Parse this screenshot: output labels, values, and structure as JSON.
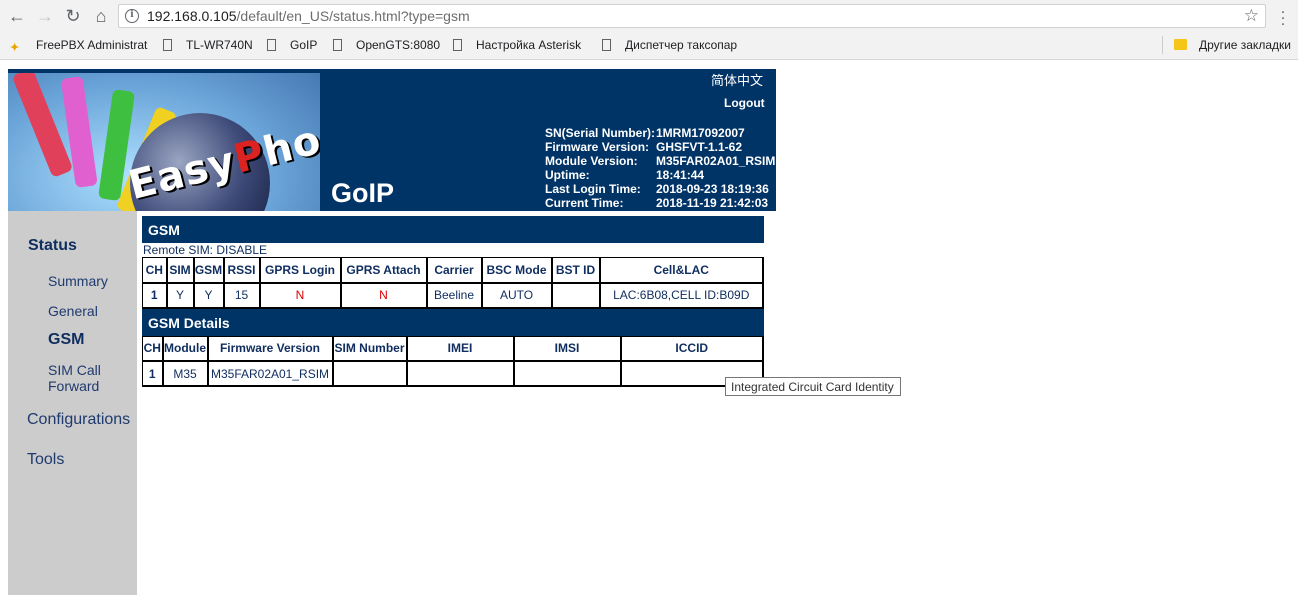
{
  "browser": {
    "url_host": "192.168.0.105",
    "url_path": "/default/en_US/status.html?type=gsm",
    "bookmarks": [
      "FreePBX Administrat",
      "TL-WR740N",
      "GoIP",
      "OpenGTS:8080",
      "Настройка Asterisk",
      "Диспетчер таксопар"
    ],
    "other_bookmarks": "Другие закладки"
  },
  "header": {
    "logo_text_left": "Easy",
    "logo_text_accent": "P",
    "logo_text_right": "hone",
    "product": "GoIP",
    "lang_link": "简体中文",
    "logout": "Logout",
    "info": [
      {
        "label": "SN(Serial Number):",
        "value": "1MRM17092007"
      },
      {
        "label": "Firmware Version:",
        "value": "GHSFVT-1.1-62"
      },
      {
        "label": "Module Version:",
        "value": "M35FAR02A01_RSIM"
      },
      {
        "label": "Uptime:",
        "value": "18:41:44"
      },
      {
        "label": "Last Login Time:",
        "value": "2018-09-23 18:19:36"
      },
      {
        "label": "Current Time:",
        "value": "2018-11-19 21:42:03"
      }
    ]
  },
  "sidebar": {
    "status": "Status",
    "summary": "Summary",
    "general": "General",
    "gsm": "GSM",
    "sim_call_forward_1": "SIM Call",
    "sim_call_forward_2": "Forward",
    "configurations": "Configurations",
    "tools": "Tools"
  },
  "gsm": {
    "title": "GSM",
    "remote_sim": "Remote SIM: DISABLE",
    "columns": [
      "CH",
      "SIM",
      "GSM",
      "RSSI",
      "GPRS Login",
      "GPRS Attach",
      "Carrier",
      "BSC Mode",
      "BST ID",
      "Cell&LAC"
    ],
    "row": [
      "1",
      "Y",
      "Y",
      "15",
      "N",
      "N",
      "Beeline",
      "AUTO",
      "",
      "LAC:6B08,CELL ID:B09D"
    ]
  },
  "details": {
    "title": "GSM Details",
    "columns": [
      "CH",
      "Module",
      "Firmware Version",
      "SIM Number",
      "IMEI",
      "IMSI",
      "ICCID"
    ],
    "row": [
      "1",
      "M35",
      "M35FAR02A01_RSIM",
      "",
      "",
      "",
      ""
    ]
  },
  "tooltip": "Integrated Circuit Card Identity"
}
